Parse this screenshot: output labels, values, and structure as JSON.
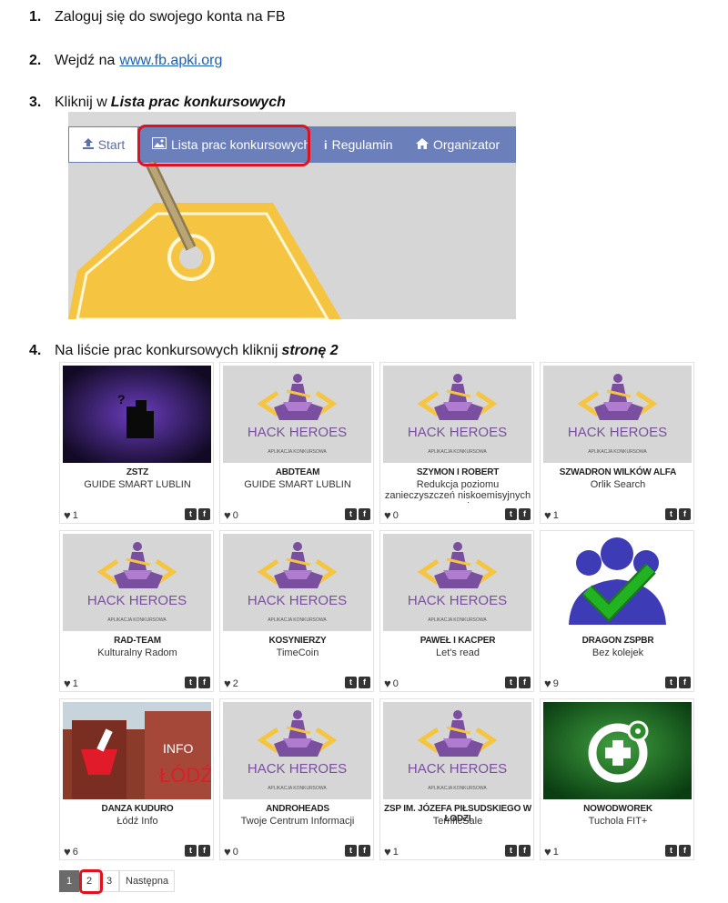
{
  "steps": [
    {
      "num": "1.",
      "text": "Zaloguj się do swojego konta na FB"
    },
    {
      "num": "2.",
      "text": "Wejdź na",
      "link": "www.fb.apki.org"
    },
    {
      "num": "3.",
      "text": "Kliknij w",
      "emphasis": "Lista prac konkursowych"
    },
    {
      "num": "4.",
      "text": "Na liście prac konkursowych kliknij",
      "emphasis": "stronę 2"
    }
  ],
  "app_nav": {
    "start": "Start",
    "lista": "Lista prac konkursowych",
    "regulamin": "Regulamin",
    "organizator": "Organizator"
  },
  "hack_logo": {
    "title": "HACK HEROES",
    "subtitle": "APLIKACJA KONKURSOWA"
  },
  "info_logo": {
    "top": "INFO",
    "bottom": "ŁÓDŹ"
  },
  "cards": [
    {
      "team": "ZSTZ",
      "project": "GUIDE SMART LUBLIN",
      "likes": "1",
      "thumb": "dark"
    },
    {
      "team": "ABDTEAM",
      "project": "GUIDE SMART LUBLIN",
      "likes": "0",
      "thumb": "hack"
    },
    {
      "team": "SZYMON I ROBERT",
      "project": "Redukcja poziomu zanieczyszczeń niskoemisyjnych w oparciu o",
      "likes": "0",
      "thumb": "hack"
    },
    {
      "team": "SZWADRON WILKÓW ALFA",
      "project": "Orlik Search",
      "likes": "1",
      "thumb": "hack"
    },
    {
      "team": "RAD-TEAM",
      "project": "Kulturalny Radom",
      "likes": "1",
      "thumb": "hack"
    },
    {
      "team": "KOSYNIERZY",
      "project": "TimeCoin",
      "likes": "2",
      "thumb": "hack"
    },
    {
      "team": "PAWEŁ I KACPER",
      "project": "Let's read",
      "likes": "0",
      "thumb": "hack"
    },
    {
      "team": "DRAGON ZSPBR",
      "project": "Bez kolejek",
      "likes": "9",
      "thumb": "check"
    },
    {
      "team": "DANZA KUDURO",
      "project": "Łódź Info",
      "likes": "6",
      "thumb": "info"
    },
    {
      "team": "ANDROHEADS",
      "project": "Twoje Centrum Informacji",
      "likes": "0",
      "thumb": "hack"
    },
    {
      "team": "ZSP IM. JÓZEFA PIŁSUDSKIEGO W ŁODZI",
      "project": "TerrificSale",
      "likes": "1",
      "thumb": "hack"
    },
    {
      "team": "NOWODWOREK",
      "project": "Tuchola FIT+",
      "likes": "1",
      "thumb": "plus"
    }
  ],
  "pagination": {
    "pages": [
      "1",
      "2",
      "3"
    ],
    "next": "Następna",
    "active": "1"
  },
  "colors": {
    "nav": "#6b7fba",
    "highlight": "#e0101d",
    "hack_purple": "#7a4fa0",
    "hack_gold": "#f5c542"
  }
}
